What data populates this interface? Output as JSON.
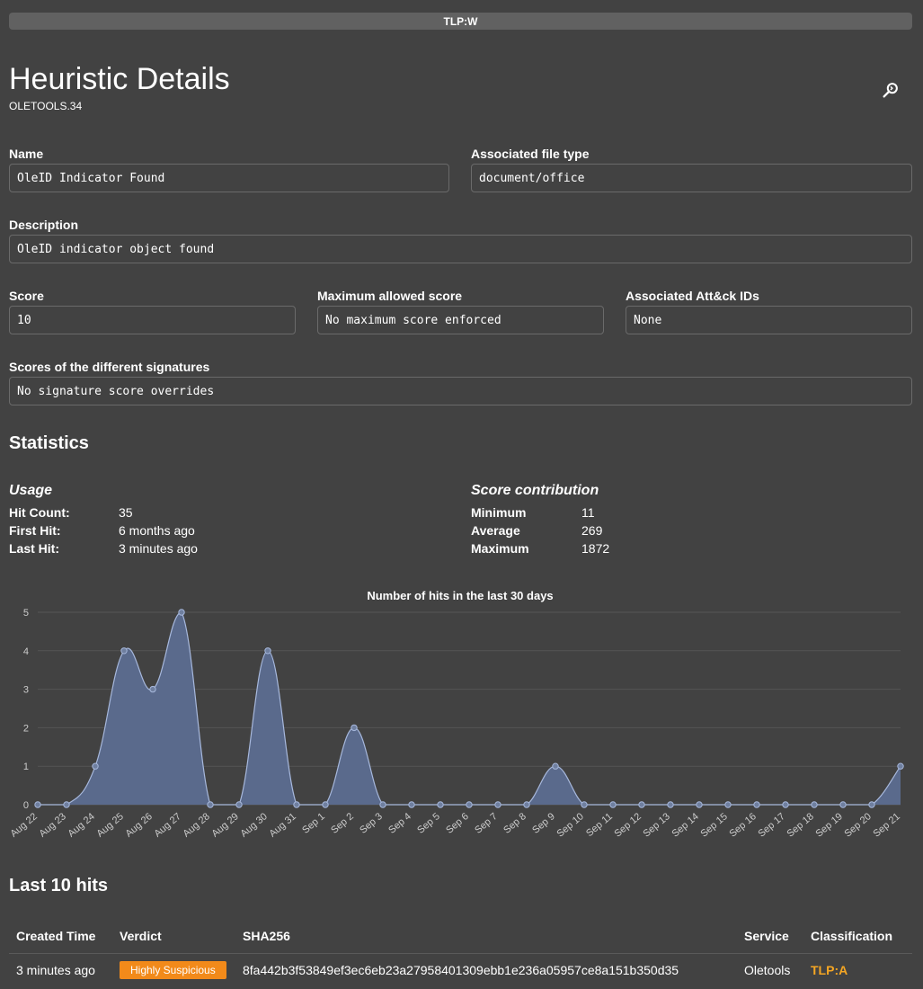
{
  "tlp_banner": "TLP:W",
  "page": {
    "title": "Heuristic Details",
    "subtitle": "OLETOOLS.34"
  },
  "fields": {
    "name": {
      "label": "Name",
      "value": "OleID Indicator Found"
    },
    "filetype": {
      "label": "Associated file type",
      "value": "document/office"
    },
    "description": {
      "label": "Description",
      "value": "OleID indicator object found"
    },
    "score": {
      "label": "Score",
      "value": "10"
    },
    "max_score": {
      "label": "Maximum allowed score",
      "value": "No maximum score enforced"
    },
    "attack_ids": {
      "label": "Associated Att&ck IDs",
      "value": "None"
    },
    "sig_scores": {
      "label": "Scores of the different signatures",
      "value": "No signature score overrides"
    }
  },
  "statistics": {
    "title": "Statistics",
    "usage": {
      "heading": "Usage",
      "rows": [
        {
          "key": "Hit Count:",
          "value": "35"
        },
        {
          "key": "First Hit:",
          "value": "6 months ago"
        },
        {
          "key": "Last Hit:",
          "value": "3 minutes ago"
        }
      ]
    },
    "score_contribution": {
      "heading": "Score contribution",
      "rows": [
        {
          "key": "Minimum",
          "value": "11"
        },
        {
          "key": "Average",
          "value": "269"
        },
        {
          "key": "Maximum",
          "value": "1872"
        }
      ]
    }
  },
  "chart_data": {
    "type": "area",
    "title": "Number of hits in the last 30 days",
    "xlabel": "",
    "ylabel": "",
    "ylim": [
      0,
      5
    ],
    "yticks": [
      "0",
      "1",
      "2",
      "3",
      "4",
      "5"
    ],
    "categories": [
      "Aug 22",
      "Aug 23",
      "Aug 24",
      "Aug 25",
      "Aug 26",
      "Aug 27",
      "Aug 28",
      "Aug 29",
      "Aug 30",
      "Aug 31",
      "Sep 1",
      "Sep 2",
      "Sep 3",
      "Sep 4",
      "Sep 5",
      "Sep 6",
      "Sep 7",
      "Sep 8",
      "Sep 9",
      "Sep 10",
      "Sep 11",
      "Sep 12",
      "Sep 13",
      "Sep 14",
      "Sep 15",
      "Sep 16",
      "Sep 17",
      "Sep 18",
      "Sep 19",
      "Sep 20",
      "Sep 21"
    ],
    "values": [
      0,
      0,
      1,
      4,
      3,
      5,
      0,
      0,
      4,
      0,
      0,
      2,
      0,
      0,
      0,
      0,
      0,
      0,
      1,
      0,
      0,
      0,
      0,
      0,
      0,
      0,
      0,
      0,
      0,
      0,
      1
    ],
    "grid": true,
    "fill_color": "#5a6a8c",
    "line_color": "#a7b8dc"
  },
  "last_hits": {
    "title": "Last 10 hits",
    "columns": [
      "Created Time",
      "Verdict",
      "SHA256",
      "Service",
      "Classification"
    ],
    "rows": [
      {
        "time": "3 minutes ago",
        "verdict": "Highly Suspicious",
        "sha256": "8fa442b3f53849ef3ec6eb23a27958401309ebb1e236a05957ce8a151b350d35",
        "service": "Oletools",
        "classification": "TLP:A"
      }
    ]
  }
}
